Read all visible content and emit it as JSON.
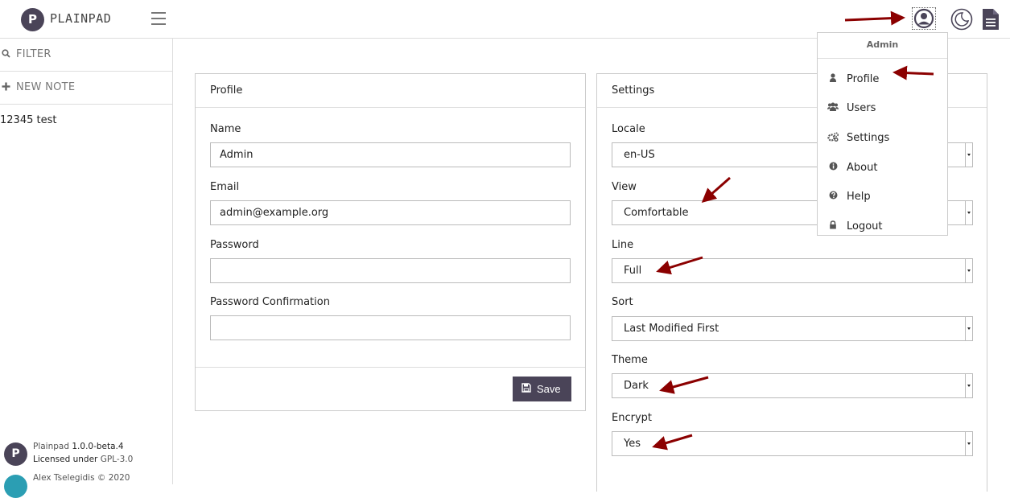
{
  "app": {
    "brand": "PLAINPAD",
    "logo_letter": "P"
  },
  "sidebar": {
    "filter_label": "FILTER",
    "new_note_label": "NEW NOTE",
    "notes": [
      "12345 test"
    ],
    "footer": {
      "line1_name": "Plainpad",
      "line1_version": "1.0.0-beta.4",
      "line2_prefix": "Licensed under",
      "line2_license": "GPL-3.0",
      "line3": "Alex Tselegidis © 2020"
    }
  },
  "profile": {
    "title": "Profile",
    "name_label": "Name",
    "name_value": "Admin",
    "email_label": "Email",
    "email_value": "admin@example.org",
    "password_label": "Password",
    "password_value": "",
    "confirm_label": "Password Confirmation",
    "confirm_value": "",
    "save_label": "Save"
  },
  "settings": {
    "title": "Settings",
    "locale_label": "Locale",
    "locale_value": "en-US",
    "view_label": "View",
    "view_value": "Comfortable",
    "line_label": "Line",
    "line_value": "Full",
    "sort_label": "Sort",
    "sort_value": "Last Modified First",
    "theme_label": "Theme",
    "theme_value": "Dark",
    "encrypt_label": "Encrypt",
    "encrypt_value": "Yes"
  },
  "user_menu": {
    "header": "Admin",
    "items": [
      {
        "label": "Profile",
        "icon": "user-icon"
      },
      {
        "label": "Users",
        "icon": "users-icon"
      },
      {
        "label": "Settings",
        "icon": "cogs-icon"
      },
      {
        "label": "About",
        "icon": "info-icon"
      },
      {
        "label": "Help",
        "icon": "question-icon"
      },
      {
        "label": "Logout",
        "icon": "lock-icon"
      }
    ]
  },
  "colors": {
    "brand": "#4a4458",
    "annotation_arrow": "#8b0000"
  }
}
